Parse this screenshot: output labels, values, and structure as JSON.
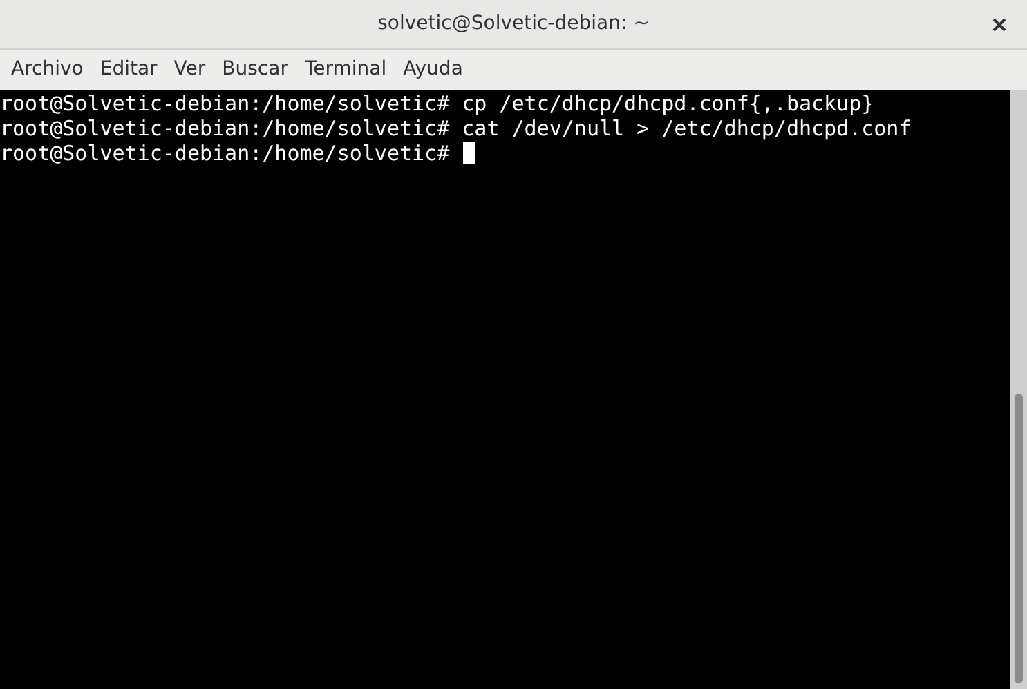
{
  "window": {
    "title": "solvetic@Solvetic-debian: ~"
  },
  "menu": [
    "Archivo",
    "Editar",
    "Ver",
    "Buscar",
    "Terminal",
    "Ayuda"
  ],
  "terminal": {
    "lines": [
      "root@Solvetic-debian:/home/solvetic# cp /etc/dhcp/dhcpd.conf{,.backup}",
      "root@Solvetic-debian:/home/solvetic# cat /dev/null > /etc/dhcp/dhcpd.conf",
      "root@Solvetic-debian:/home/solvetic#"
    ],
    "cursor_visible": true
  }
}
